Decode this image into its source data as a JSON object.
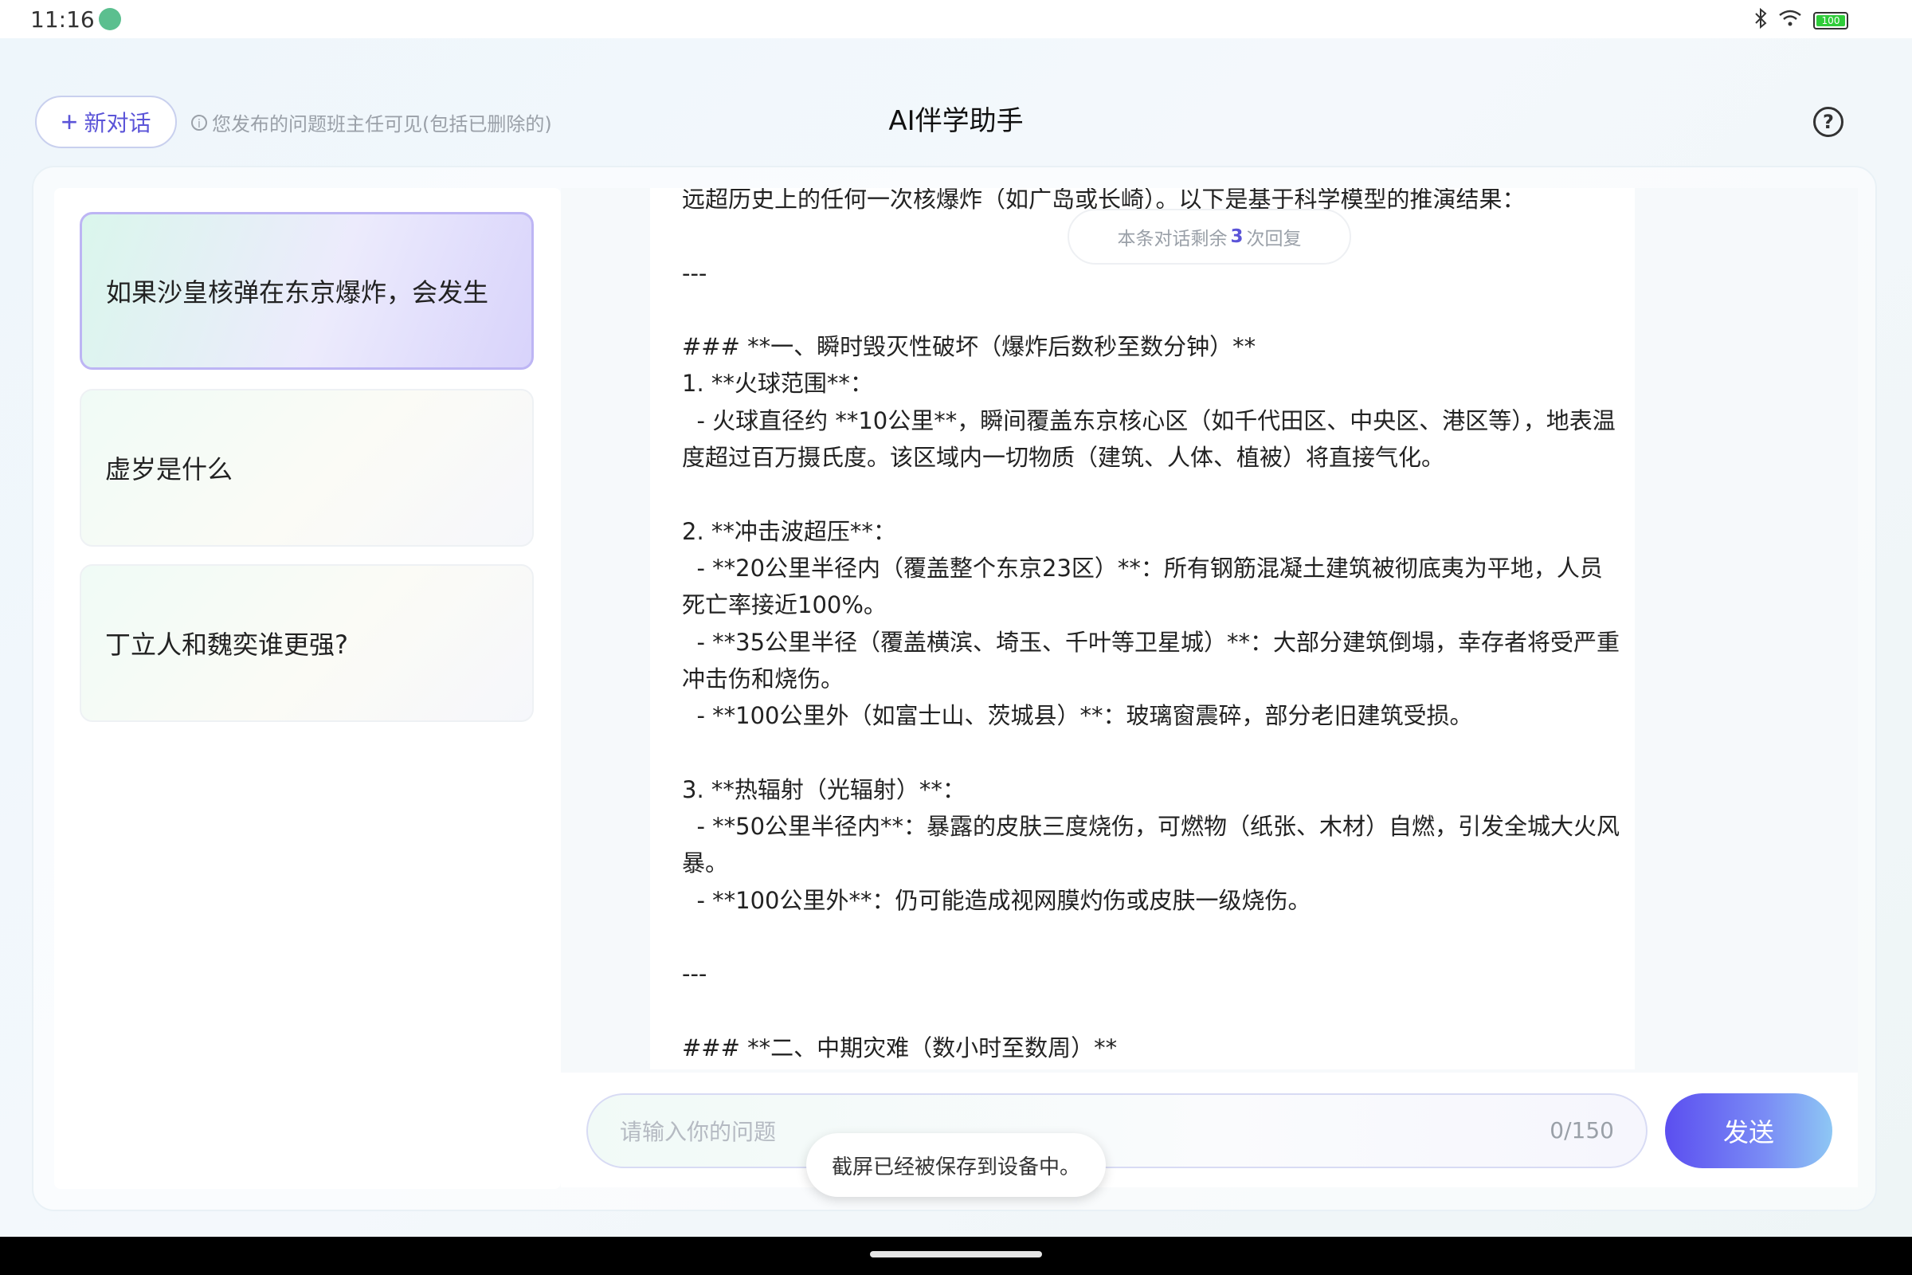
{
  "statusbar": {
    "time": "11:16",
    "icons": [
      "bluetooth-icon",
      "wifi-icon",
      "battery-icon"
    ],
    "battery_level": 1.0,
    "battery_label": "100"
  },
  "header": {
    "new_chat_label": "新对话",
    "notice": "您发布的问题班主任可见(包括已删除的)",
    "title": "AI伴学助手"
  },
  "sidebar": {
    "items": [
      {
        "label": "如果沙皇核弹在东京爆炸，会发生",
        "active": true
      },
      {
        "label": "虚岁是什么",
        "active": false
      },
      {
        "label": "丁立人和魏奕谁更强?",
        "active": false
      }
    ]
  },
  "chat": {
    "remaining_prefix": "本条对话剩余",
    "remaining_count": "3",
    "remaining_suffix": "次回复",
    "message_text": "远超历史上的任何一次核爆炸（如广岛或长崎）。以下是基于科学模型的推演结果：\n\n---\n\n### **一、瞬时毁灭性破坏（爆炸后数秒至数分钟）**\n1. **火球范围**：\n  - 火球直径约 **10公里**，瞬间覆盖东京核心区（如千代田区、中央区、港区等），地表温度超过百万摄氏度。该区域内一切物质（建筑、人体、植被）将直接气化。\n\n2. **冲击波超压**：\n  - **20公里半径内（覆盖整个东京23区）**：所有钢筋混凝土建筑被彻底夷为平地，人员死亡率接近100%。\n  - **35公里半径（覆盖横滨、埼玉、千叶等卫星城）**：大部分建筑倒塌，幸存者将受严重冲击伤和烧伤。\n  - **100公里外（如富士山、茨城县）**：玻璃窗震碎，部分老旧建筑受损。\n\n3. **热辐射（光辐射）**：\n  - **50公里半径内**：暴露的皮肤三度烧伤，可燃物（纸张、木材）自燃，引发全城大火风暴。\n  - **100公里外**：仍可能造成视网膜灼伤或皮肤一级烧伤。\n\n---\n\n### **二、中期灾难（数小时至数周）**"
  },
  "input": {
    "placeholder": "请输入你的问题",
    "counter": "0/150",
    "send_label": "发送"
  },
  "toast": {
    "text": "截屏已经被保存到设备中。"
  }
}
